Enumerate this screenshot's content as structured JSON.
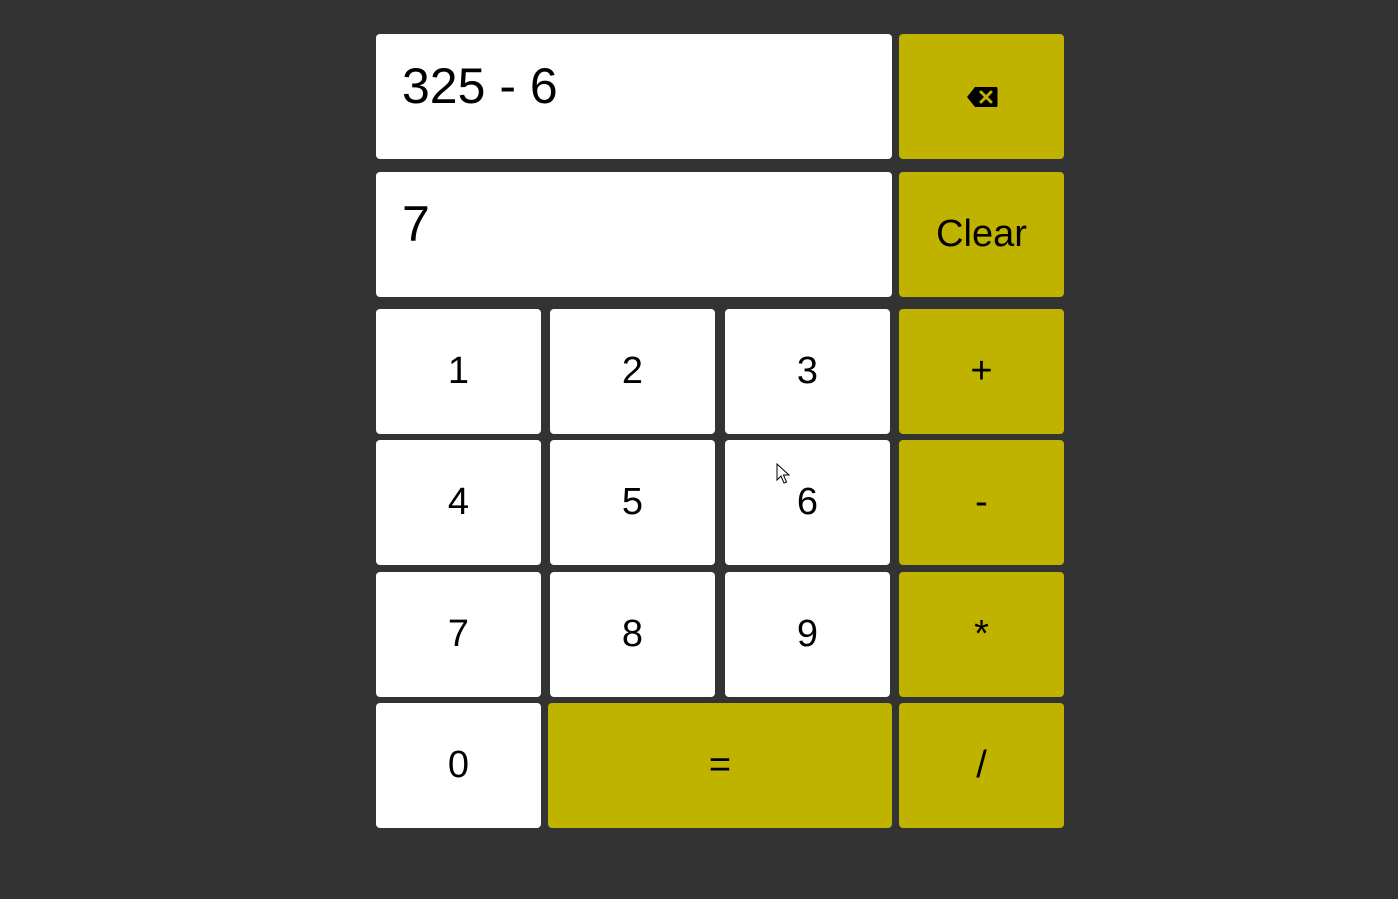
{
  "display": {
    "expression": "325 - 6",
    "current": "7"
  },
  "controls": {
    "backspace_icon": "backspace-icon",
    "clear_label": "Clear"
  },
  "keys": {
    "one": "1",
    "two": "2",
    "three": "3",
    "four": "4",
    "five": "5",
    "six": "6",
    "seven": "7",
    "eight": "8",
    "nine": "9",
    "zero": "0",
    "plus": "+",
    "minus": "-",
    "multiply": "*",
    "divide": "/",
    "equals": "="
  },
  "colors": {
    "background": "#333333",
    "accent": "#bfb300",
    "key": "#ffffff"
  }
}
